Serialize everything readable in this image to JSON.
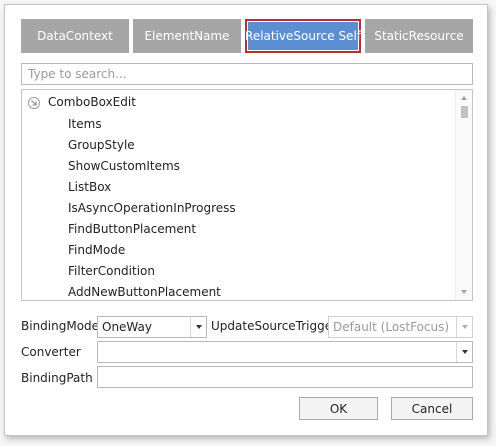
{
  "tabs": [
    {
      "label": "DataContext"
    },
    {
      "label": "ElementName"
    },
    {
      "label": "RelativeSource Self"
    },
    {
      "label": "StaticResource"
    }
  ],
  "search": {
    "placeholder": "Type to search..."
  },
  "tree": {
    "root": "ComboBoxEdit",
    "items": [
      "Items",
      "GroupStyle",
      "ShowCustomItems",
      "ListBox",
      "IsAsyncOperationInProgress",
      "FindButtonPlacement",
      "FindMode",
      "FilterCondition",
      "AddNewButtonPlacement"
    ]
  },
  "binding_mode": {
    "label": "BindingMode",
    "value": "OneWay"
  },
  "update_source_trigger": {
    "label": "UpdateSourceTrigger",
    "value": "Default (LostFocus)"
  },
  "converter": {
    "label": "Converter",
    "value": ""
  },
  "binding_path": {
    "label": "BindingPath",
    "value": ""
  },
  "buttons": {
    "ok": "OK",
    "cancel": "Cancel"
  },
  "colors": {
    "active_tab": "#5b8fd1",
    "inactive_tab": "#a6a6a6",
    "active_tab_border": "#b03030"
  }
}
